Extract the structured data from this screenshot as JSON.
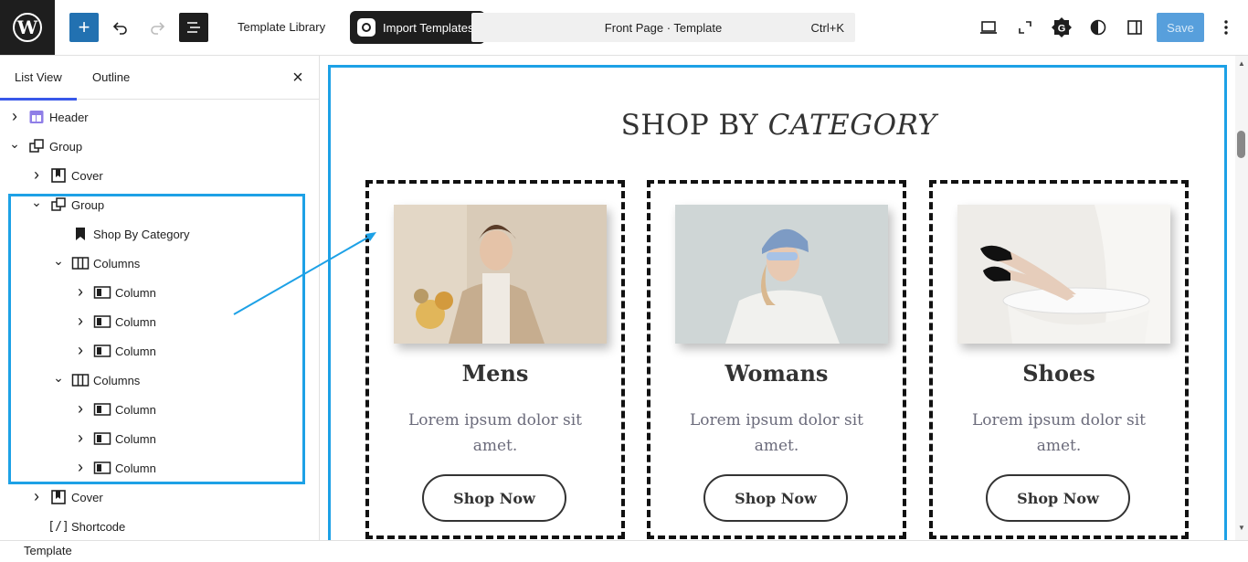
{
  "topbar": {
    "template_library": "Template Library",
    "import_templates": "Import Templates",
    "command_title": "Front Page · Template",
    "command_shortcut": "Ctrl+K",
    "save": "Save",
    "accent_color": "#2271b1"
  },
  "sidebar": {
    "tabs": [
      "List View",
      "Outline"
    ],
    "tree": [
      {
        "label": "Header",
        "icon": "template-part-icon",
        "expand": "collapsed"
      },
      {
        "label": "Group",
        "icon": "group-icon",
        "expand": "expanded"
      },
      {
        "label": "Cover",
        "icon": "cover-icon",
        "expand": "collapsed"
      },
      {
        "label": "Group",
        "icon": "group-icon",
        "expand": "expanded"
      },
      {
        "label": "Shop By Category",
        "icon": "bookmark-icon",
        "expand": "none"
      },
      {
        "label": "Columns",
        "icon": "columns-icon",
        "expand": "expanded"
      },
      {
        "label": "Column",
        "icon": "column-icon",
        "expand": "collapsed"
      },
      {
        "label": "Column",
        "icon": "column-icon",
        "expand": "collapsed"
      },
      {
        "label": "Column",
        "icon": "column-icon",
        "expand": "collapsed"
      },
      {
        "label": "Columns",
        "icon": "columns-icon",
        "expand": "expanded"
      },
      {
        "label": "Column",
        "icon": "column-icon",
        "expand": "collapsed"
      },
      {
        "label": "Column",
        "icon": "column-icon",
        "expand": "collapsed"
      },
      {
        "label": "Column",
        "icon": "column-icon",
        "expand": "collapsed"
      },
      {
        "label": "Cover",
        "icon": "cover-icon",
        "expand": "collapsed"
      },
      {
        "label": "Shortcode",
        "icon": "shortcode-icon",
        "expand": "none"
      }
    ]
  },
  "footer": {
    "breadcrumb": "Template"
  },
  "canvas": {
    "heading_plain": "SHOP BY ",
    "heading_italic": "CATEGORY",
    "cards": [
      {
        "title": "Mens",
        "text": "Lorem ipsum dolor sit amet.",
        "button": "Shop Now"
      },
      {
        "title": "Womans",
        "text": "Lorem ipsum dolor sit amet.",
        "button": "Shop Now"
      },
      {
        "title": "Shoes",
        "text": "Lorem ipsum dolor sit amet.",
        "button": "Shop Now"
      }
    ],
    "highlight_color": "#1da1e6"
  }
}
